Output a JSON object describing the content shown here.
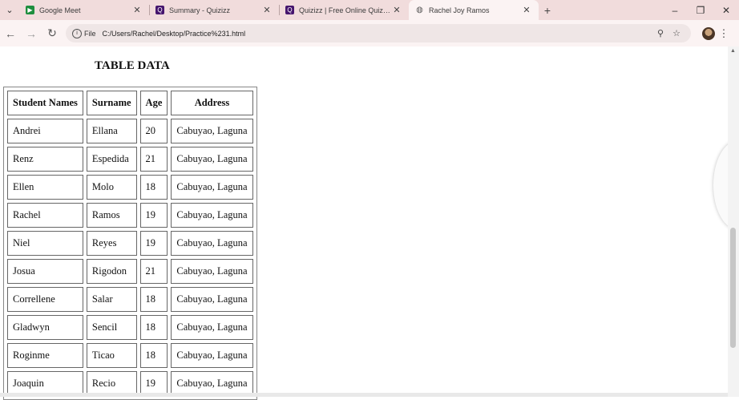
{
  "browser": {
    "tabs": [
      {
        "title": "Google Meet",
        "icon": "google-meet-icon",
        "color": "#1e8e3e"
      },
      {
        "title": "Summary - Quizizz",
        "icon": "quizizz-icon",
        "color": "#46166e"
      },
      {
        "title": "Quizizz | Free Online Quizzes, L...",
        "icon": "quizizz-icon",
        "color": "#46166e"
      },
      {
        "title": "Rachel Joy Ramos",
        "icon": "globe-icon",
        "color": "#555555",
        "active": true
      }
    ],
    "address": {
      "chip_label": "File",
      "url": "C:/Users/Rachel/Desktop/Practice%231.html"
    }
  },
  "page": {
    "heading": "TABLE DATA",
    "table": {
      "headers": [
        "Student Names",
        "Surname",
        "Age",
        "Address"
      ],
      "rows": [
        [
          "Andrei",
          "Ellana",
          "20",
          "Cabuyao, Laguna"
        ],
        [
          "Renz",
          "Espedida",
          "21",
          "Cabuyao, Laguna"
        ],
        [
          "Ellen",
          "Molo",
          "18",
          "Cabuyao, Laguna"
        ],
        [
          "Rachel",
          "Ramos",
          "19",
          "Cabuyao, Laguna"
        ],
        [
          "Niel",
          "Reyes",
          "19",
          "Cabuyao, Laguna"
        ],
        [
          "Josua",
          "Rigodon",
          "21",
          "Cabuyao, Laguna"
        ],
        [
          "Correllene",
          "Salar",
          "18",
          "Cabuyao, Laguna"
        ],
        [
          "Gladwyn",
          "Sencil",
          "18",
          "Cabuyao, Laguna"
        ],
        [
          "Roginme",
          "Ticao",
          "18",
          "Cabuyao, Laguna"
        ],
        [
          "Joaquin",
          "Recio",
          "19",
          "Cabuyao, Laguna"
        ]
      ]
    }
  },
  "colors": {
    "tabstrip": "#f1dcdc",
    "toolbar": "#fbf3f3"
  }
}
